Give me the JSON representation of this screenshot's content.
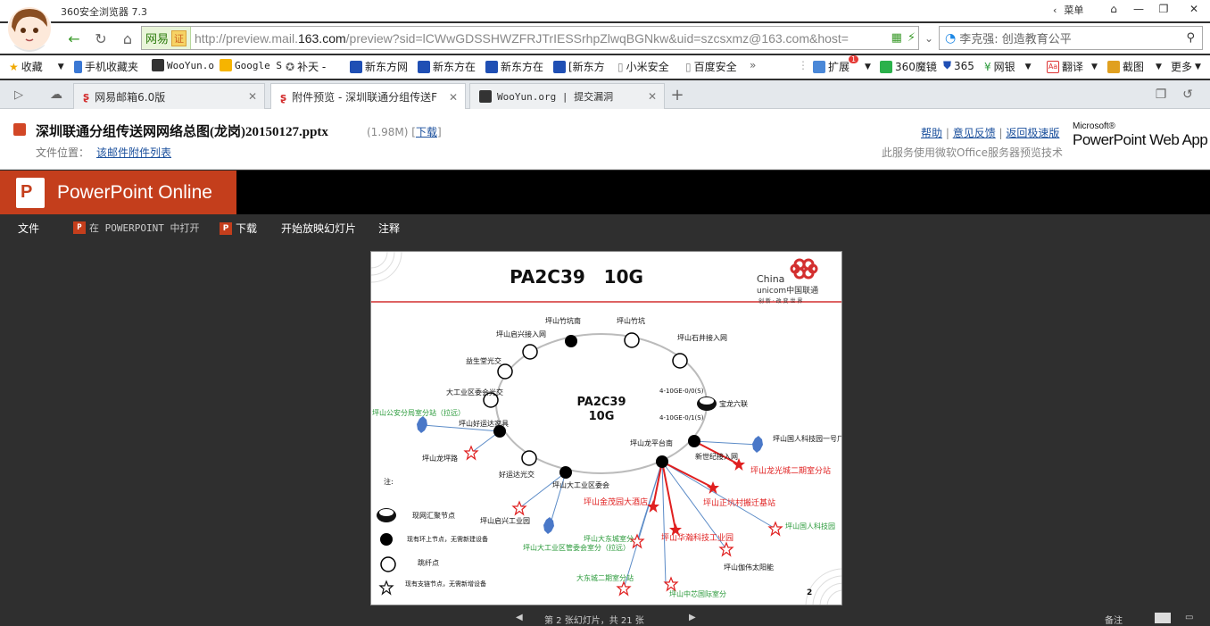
{
  "browser": {
    "title": "360安全浏览器 7.3",
    "menu_label": "菜单",
    "url_prefix": "http://preview.mail.",
    "url_domain": "163.com",
    "url_rest": "/preview?sid=lCWwGDSSHWZFRJTrIESSrhpZlwqBGNkw&uid=szcsxmz@163.com&host=",
    "security_label": "网易",
    "security_badge": "证",
    "search_text": "李克强: 创造教育公平"
  },
  "favorites": [
    {
      "label": "收藏",
      "icon": "star-icon"
    },
    {
      "label": "手机收藏夹",
      "icon": "phone-icon"
    },
    {
      "label": "WooYun.o",
      "icon": "wooyun-icon"
    },
    {
      "label": "Google S",
      "icon": "google-icon"
    },
    {
      "label": "补天 -",
      "icon": "butian-icon"
    },
    {
      "label": "新东方网",
      "icon": "paw-icon"
    },
    {
      "label": "新东方在",
      "icon": "paw-icon"
    },
    {
      "label": "新东方在",
      "icon": "paw-icon"
    },
    {
      "label": "[新东方",
      "icon": "paw-icon"
    },
    {
      "label": "小米安全",
      "icon": "page-icon"
    },
    {
      "label": "百度安全",
      "icon": "page-icon"
    }
  ],
  "toolbar_right": [
    {
      "label": "扩展",
      "badge": "1"
    },
    {
      "label": "360魔镜"
    },
    {
      "label": "365"
    },
    {
      "label": "网银"
    },
    {
      "label": "翻译"
    },
    {
      "label": "截图"
    },
    {
      "label": "更多"
    }
  ],
  "tabs": [
    {
      "label": "网易邮箱6.0版",
      "active": false
    },
    {
      "label": "附件预览 - 深圳联通分组传送F",
      "active": true
    },
    {
      "label": "WooYun.org | 提交漏洞",
      "active": false
    }
  ],
  "attachment": {
    "filename": "深圳联通分组传送网网络总图(龙岗)20150127.pptx",
    "size": "(1.98M)",
    "download_label": "下载",
    "location_label": "文件位置：",
    "location_link": "该邮件附件列表",
    "help_link": "帮助",
    "feedback_link": "意见反馈",
    "fast_link": "返回极速版",
    "service_note": "此服务使用微软Office服务器预览技术",
    "ms_label": "Microsoft®",
    "ppwa_label": "PowerPoint Web App"
  },
  "ppt": {
    "brand": "PowerPoint Online",
    "menu": [
      {
        "label": "文件",
        "icon": false
      },
      {
        "label": "在 POWERPOINT 中打开",
        "icon": true
      },
      {
        "label": "下载",
        "icon": true
      },
      {
        "label": "开始放映幻灯片",
        "icon": false
      },
      {
        "label": "注释",
        "icon": false
      }
    ]
  },
  "slide": {
    "title": "PA2C39   10G",
    "center_line1": "PA2C39",
    "center_line2": "10G",
    "logo_line1": "China",
    "logo_line2": "unicom中国联通",
    "logo_slogan": "创 新 · 改 变 世 界",
    "page_number": "2",
    "note_label": "注:",
    "legend": [
      "现网汇聚节点",
      "现有环上节点，无需新建设备",
      "跳纤点",
      "现有支链节点，无需新增设备"
    ],
    "labels": {
      "n_zhukeng_nan": "坪山竹坑南",
      "n_zhukeng": "坪山竹坑",
      "n_qixing": "坪山启兴接入网",
      "n_shijing": "坪山石井接入网",
      "n_yishengtang": "益生堂光交",
      "n_dagongye_wei": "大工业区委会光交",
      "n_baolong": "宝龙六联",
      "n_port1": "4-10GE-0/0(S)",
      "n_port2": "4-10GE-0/1(S)",
      "n_haoyunda": "坪山好运达家具",
      "n_gongan": "坪山公安分局室分站（拉远）",
      "n_longping_lu": "坪山龙坪路",
      "n_haoyunda_gj": "好运达光交",
      "n_dagongye_qu": "坪山大工业区委会",
      "n_qixing_gy": "坪山启兴工业园",
      "n_dagongye_gw": "坪山大工业区管委会室分（拉远）",
      "n_longping_tai": "坪山龙平台南",
      "n_xinshiji": "新世纪接入网",
      "n_guoren_1hao": "坪山国人科技园一号厂房（拉远）",
      "n_longguang": "坪山龙光城二期室分站",
      "n_jinmao": "坪山金茂园大酒店",
      "n_zhengkeng": "坪山正坑村搬迁基站",
      "n_dadong_cheng": "坪山大东城室分",
      "n_huahan": "坪山华瀚科技工业园",
      "n_guoren_kj": "坪山国人科技园",
      "n_gaowei": "坪山伽伟太阳能",
      "n_dadong_2": "大东城二期室分站",
      "n_zhongxin": "坪山中芯国际室分"
    }
  },
  "status": {
    "slide_counter": "第 2 张幻灯片，共 21 张",
    "notes_label": "备注"
  }
}
